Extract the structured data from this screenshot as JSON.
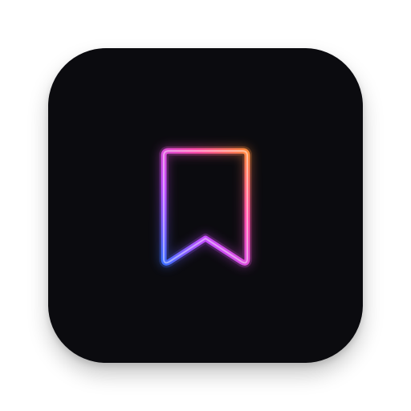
{
  "app_icon": {
    "icon": "bookmark-icon",
    "background_color": "#0b0b0f",
    "gradient_colors": {
      "top_right": "#ff8a3d",
      "top": "#ff4fa8",
      "left": "#c44dff",
      "bottom_left": "#3d6bff"
    }
  }
}
